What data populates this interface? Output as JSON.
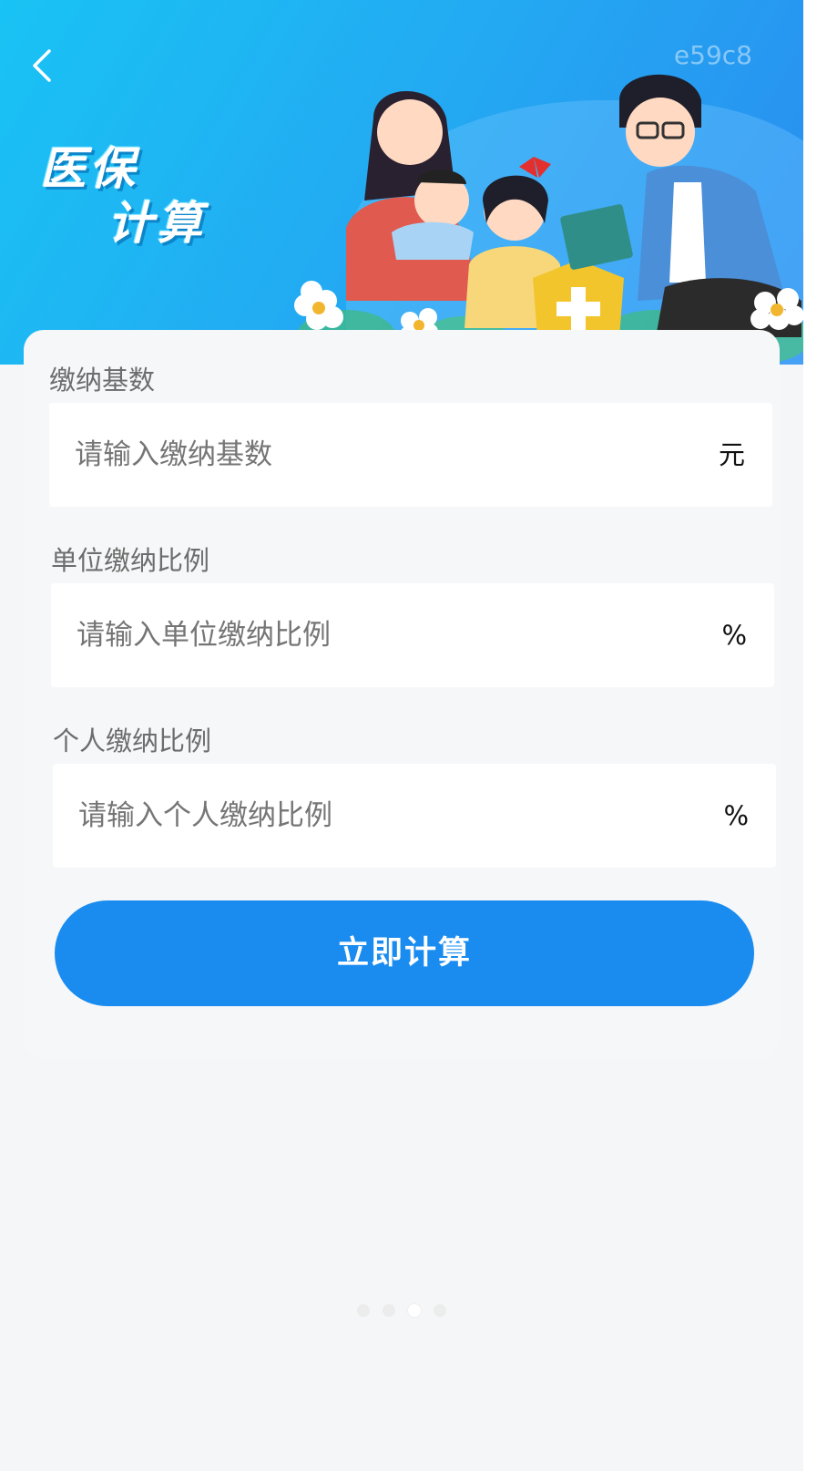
{
  "header": {
    "code": "e59c8",
    "title_line1": "医保",
    "title_line2": "计算",
    "back_icon": "chevron-left-icon"
  },
  "form": {
    "base": {
      "label": "缴纳基数",
      "placeholder": "请输入缴纳基数",
      "unit": "元"
    },
    "company_ratio": {
      "label": "单位缴纳比例",
      "placeholder": "请输入单位缴纳比例",
      "unit": "%"
    },
    "personal_ratio": {
      "label": "个人缴纳比例",
      "placeholder": "请输入个人缴纳比例",
      "unit": "%"
    }
  },
  "actions": {
    "calculate_label": "立即计算"
  },
  "pager": {
    "count": 4,
    "active_index": 2
  },
  "colors": {
    "banner_start": "#19c3f4",
    "banner_end": "#2a8cf0",
    "button": "#1a8cf0",
    "background": "#f5f6f7"
  }
}
